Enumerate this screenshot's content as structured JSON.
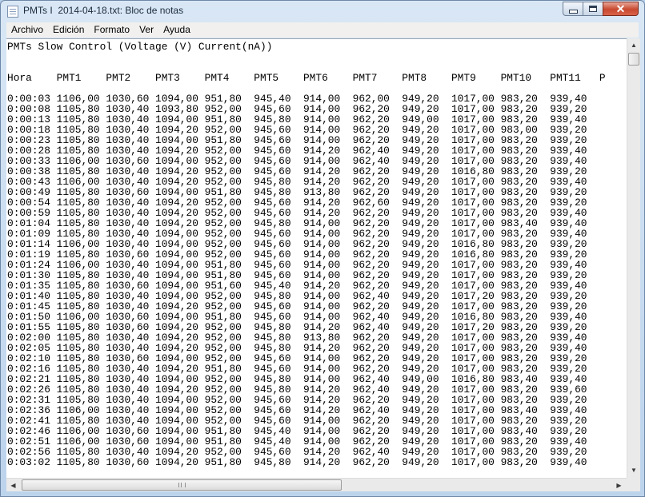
{
  "window": {
    "title": "PMTs I  2014-04-18.txt: Bloc de notas",
    "minimize_icon": "minimize-icon",
    "maximize_icon": "maximize-icon",
    "close_icon": "close-icon",
    "close_color": "#c8492f"
  },
  "menu": [
    "Archivo",
    "Edición",
    "Formato",
    "Ver",
    "Ayuda"
  ],
  "document": {
    "heading": "PMTs Slow Control (Voltage (V) Current(nA))",
    "columns": [
      "Hora",
      "PMT1",
      "PMT2",
      "PMT3",
      "PMT4",
      "PMT5",
      "PMT6",
      "PMT7",
      "PMT8",
      "PMT9",
      "PMT10",
      "PMT11",
      "P"
    ],
    "rows": [
      [
        "0:00:03",
        "1106,00",
        "1030,60",
        "1094,00",
        "951,80",
        "945,40",
        "914,00",
        "962,00",
        "949,20",
        "1017,00",
        "983,20",
        "939,40"
      ],
      [
        "0:00:08",
        "1105,80",
        "1030,40",
        "1093,80",
        "952,00",
        "945,60",
        "914,00",
        "962,20",
        "949,20",
        "1017,00",
        "983,20",
        "939,20"
      ],
      [
        "0:00:13",
        "1105,80",
        "1030,40",
        "1094,00",
        "951,80",
        "945,80",
        "914,00",
        "962,20",
        "949,00",
        "1017,00",
        "983,20",
        "939,40"
      ],
      [
        "0:00:18",
        "1105,80",
        "1030,40",
        "1094,20",
        "952,00",
        "945,60",
        "914,00",
        "962,20",
        "949,20",
        "1017,00",
        "983,00",
        "939,20"
      ],
      [
        "0:00:23",
        "1105,80",
        "1030,40",
        "1094,00",
        "951,80",
        "945,60",
        "914,00",
        "962,20",
        "949,20",
        "1017,00",
        "983,20",
        "939,20"
      ],
      [
        "0:00:28",
        "1105,80",
        "1030,40",
        "1094,20",
        "952,00",
        "945,60",
        "914,20",
        "962,40",
        "949,20",
        "1017,00",
        "983,20",
        "939,40"
      ],
      [
        "0:00:33",
        "1106,00",
        "1030,60",
        "1094,00",
        "952,00",
        "945,60",
        "914,00",
        "962,40",
        "949,20",
        "1017,00",
        "983,20",
        "939,40"
      ],
      [
        "0:00:38",
        "1105,80",
        "1030,40",
        "1094,20",
        "952,00",
        "945,60",
        "914,20",
        "962,20",
        "949,20",
        "1016,80",
        "983,20",
        "939,20"
      ],
      [
        "0:00:43",
        "1106,00",
        "1030,40",
        "1094,20",
        "952,00",
        "945,80",
        "914,20",
        "962,20",
        "949,20",
        "1017,00",
        "983,20",
        "939,40"
      ],
      [
        "0:00:49",
        "1105,80",
        "1030,60",
        "1094,00",
        "951,80",
        "945,80",
        "913,80",
        "962,20",
        "949,20",
        "1017,00",
        "983,20",
        "939,20"
      ],
      [
        "0:00:54",
        "1105,80",
        "1030,40",
        "1094,20",
        "952,00",
        "945,60",
        "914,20",
        "962,60",
        "949,20",
        "1017,00",
        "983,20",
        "939,20"
      ],
      [
        "0:00:59",
        "1105,80",
        "1030,40",
        "1094,20",
        "952,00",
        "945,60",
        "914,20",
        "962,20",
        "949,20",
        "1017,00",
        "983,20",
        "939,40"
      ],
      [
        "0:01:04",
        "1105,80",
        "1030,40",
        "1094,20",
        "952,00",
        "945,80",
        "914,00",
        "962,20",
        "949,20",
        "1017,00",
        "983,40",
        "939,40"
      ],
      [
        "0:01:09",
        "1105,80",
        "1030,40",
        "1094,00",
        "952,00",
        "945,60",
        "914,00",
        "962,20",
        "949,20",
        "1017,00",
        "983,20",
        "939,40"
      ],
      [
        "0:01:14",
        "1106,00",
        "1030,40",
        "1094,00",
        "952,00",
        "945,60",
        "914,00",
        "962,20",
        "949,20",
        "1016,80",
        "983,20",
        "939,20"
      ],
      [
        "0:01:19",
        "1105,80",
        "1030,60",
        "1094,00",
        "952,00",
        "945,60",
        "914,00",
        "962,20",
        "949,20",
        "1016,80",
        "983,20",
        "939,20"
      ],
      [
        "0:01:24",
        "1106,00",
        "1030,40",
        "1094,00",
        "951,80",
        "945,60",
        "914,00",
        "962,20",
        "949,20",
        "1017,00",
        "983,20",
        "939,40"
      ],
      [
        "0:01:30",
        "1105,80",
        "1030,40",
        "1094,00",
        "951,80",
        "945,60",
        "914,00",
        "962,20",
        "949,20",
        "1017,00",
        "983,20",
        "939,20"
      ],
      [
        "0:01:35",
        "1105,80",
        "1030,60",
        "1094,00",
        "951,60",
        "945,40",
        "914,20",
        "962,20",
        "949,20",
        "1017,00",
        "983,20",
        "939,40"
      ],
      [
        "0:01:40",
        "1105,80",
        "1030,40",
        "1094,00",
        "952,00",
        "945,80",
        "914,00",
        "962,40",
        "949,20",
        "1017,20",
        "983,20",
        "939,20"
      ],
      [
        "0:01:45",
        "1105,80",
        "1030,40",
        "1094,20",
        "952,00",
        "945,60",
        "914,00",
        "962,20",
        "949,20",
        "1017,00",
        "983,20",
        "939,20"
      ],
      [
        "0:01:50",
        "1106,00",
        "1030,60",
        "1094,00",
        "951,80",
        "945,60",
        "914,00",
        "962,40",
        "949,20",
        "1016,80",
        "983,20",
        "939,40"
      ],
      [
        "0:01:55",
        "1105,80",
        "1030,60",
        "1094,20",
        "952,00",
        "945,80",
        "914,20",
        "962,40",
        "949,20",
        "1017,20",
        "983,20",
        "939,20"
      ],
      [
        "0:02:00",
        "1105,80",
        "1030,40",
        "1094,20",
        "952,00",
        "945,80",
        "913,80",
        "962,20",
        "949,20",
        "1017,00",
        "983,20",
        "939,40"
      ],
      [
        "0:02:05",
        "1105,80",
        "1030,40",
        "1094,20",
        "952,00",
        "945,80",
        "914,20",
        "962,20",
        "949,20",
        "1017,00",
        "983,20",
        "939,40"
      ],
      [
        "0:02:10",
        "1105,80",
        "1030,60",
        "1094,00",
        "952,00",
        "945,60",
        "914,00",
        "962,20",
        "949,20",
        "1017,00",
        "983,20",
        "939,20"
      ],
      [
        "0:02:16",
        "1105,80",
        "1030,40",
        "1094,20",
        "951,80",
        "945,60",
        "914,00",
        "962,20",
        "949,20",
        "1017,00",
        "983,20",
        "939,20"
      ],
      [
        "0:02:21",
        "1105,80",
        "1030,40",
        "1094,00",
        "952,00",
        "945,80",
        "914,00",
        "962,40",
        "949,00",
        "1016,80",
        "983,40",
        "939,40"
      ],
      [
        "0:02:26",
        "1105,80",
        "1030,40",
        "1094,20",
        "952,00",
        "945,80",
        "914,20",
        "962,40",
        "949,20",
        "1017,00",
        "983,20",
        "939,60"
      ],
      [
        "0:02:31",
        "1105,80",
        "1030,40",
        "1094,00",
        "952,00",
        "945,60",
        "914,20",
        "962,20",
        "949,20",
        "1017,00",
        "983,20",
        "939,20"
      ],
      [
        "0:02:36",
        "1106,00",
        "1030,40",
        "1094,00",
        "952,00",
        "945,60",
        "914,20",
        "962,40",
        "949,20",
        "1017,00",
        "983,40",
        "939,40"
      ],
      [
        "0:02:41",
        "1105,80",
        "1030,40",
        "1094,00",
        "952,00",
        "945,60",
        "914,00",
        "962,20",
        "949,20",
        "1017,00",
        "983,20",
        "939,20"
      ],
      [
        "0:02:46",
        "1106,00",
        "1030,60",
        "1094,00",
        "951,80",
        "945,40",
        "914,00",
        "962,20",
        "949,20",
        "1017,00",
        "983,40",
        "939,20"
      ],
      [
        "0:02:51",
        "1106,00",
        "1030,60",
        "1094,00",
        "951,80",
        "945,40",
        "914,00",
        "962,20",
        "949,20",
        "1017,00",
        "983,20",
        "939,40"
      ],
      [
        "0:02:56",
        "1105,80",
        "1030,40",
        "1094,20",
        "952,00",
        "945,60",
        "914,20",
        "962,40",
        "949,20",
        "1017,00",
        "983,20",
        "939,20"
      ],
      [
        "0:03:02",
        "1105,80",
        "1030,60",
        "1094,20",
        "951,80",
        "945,80",
        "914,20",
        "962,20",
        "949,20",
        "1017,00",
        "983,20",
        "939,40"
      ]
    ]
  },
  "scrollbars": {
    "up_icon": "arrow-up-icon",
    "down_icon": "arrow-down-icon",
    "left_icon": "arrow-left-icon",
    "right_icon": "arrow-right-icon"
  }
}
